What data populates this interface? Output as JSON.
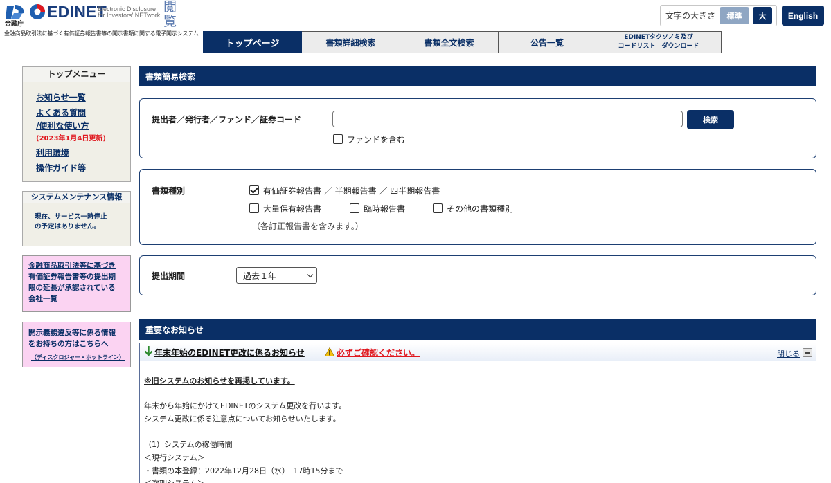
{
  "header": {
    "fsa_text": "金融庁",
    "logo_name": "EDINET",
    "logo_sub_line1": "Electronic Disclosure",
    "logo_sub_line2": "for Investors' NETwork",
    "logo_kanji": "閲覧",
    "tagline": "金融商品取引法に基づく有価証券報告書等の開示書類に関する電子開示システム",
    "font_size_label": "文字の大きさ",
    "font_size_normal": "標準",
    "font_size_large": "大",
    "english_label": "English"
  },
  "nav": {
    "tabs": [
      {
        "label": "トップページ"
      },
      {
        "label": "書類詳細検索"
      },
      {
        "label": "書類全文検索"
      },
      {
        "label": "公告一覧"
      },
      {
        "label_line1": "EDINETタクソノミ及び",
        "label_line2": "コードリスト　ダウンロード"
      }
    ]
  },
  "sidebar": {
    "top_menu_title": "トップメニュー",
    "links": [
      "お知らせ一覧",
      "よくある質問",
      "/便利な使い方",
      "利用環境",
      "操作ガイド等"
    ],
    "updated_note": "(2023年1月4日更新)",
    "maintenance_title": "システムメンテナンス情報",
    "maintenance_line1": "現在、サービス一時停止",
    "maintenance_line2": "の予定はありません。",
    "extension_lines": [
      "金融商品取引法等に基づき",
      "有価証券報告書等の提出期",
      "限の延長が承認されている",
      "会社一覧"
    ],
    "hotline_lines": [
      "開示義務違反等に係る情報",
      "をお持ちの方はこちらへ"
    ],
    "hotline_small": "（ディスクロジャー・ホットライン）"
  },
  "search": {
    "section_title": "書類簡易検索",
    "submitter_label": "提出者／発行者／ファンド／証券コード",
    "search_value": "",
    "search_button": "検索",
    "include_fund_label": "ファンドを含む",
    "include_fund_checked": false,
    "doctype_label": "書類種別",
    "doc_types": [
      {
        "label": "有価証券報告書 ／ 半期報告書 ／ 四半期報告書",
        "checked": true
      },
      {
        "label": "大量保有報告書",
        "checked": false
      },
      {
        "label": "臨時報告書",
        "checked": false
      },
      {
        "label": "その他の書類種別",
        "checked": false
      }
    ],
    "doctype_note": "（各訂正報告書を含みます。）",
    "period_label": "提出期間",
    "period_selected": "過去１年"
  },
  "notice": {
    "section_title": "重要なお知らせ",
    "title": "年末年始のEDINET更改に係るお知らせ",
    "warning": "必ずご確認ください。",
    "close_label": "閉じる",
    "lines": [
      "※旧システムのお知らせを再掲しています。",
      "年末から年始にかけてEDINETのシステム更改を行います。",
      "システム更改に係る注意点についてお知らせいたします。",
      "（1）システムの稼働時間",
      "＜現行システム＞",
      "・書類の本登録：2022年12月28日（水）　17時15分まで",
      "＜次期システム＞"
    ]
  }
}
